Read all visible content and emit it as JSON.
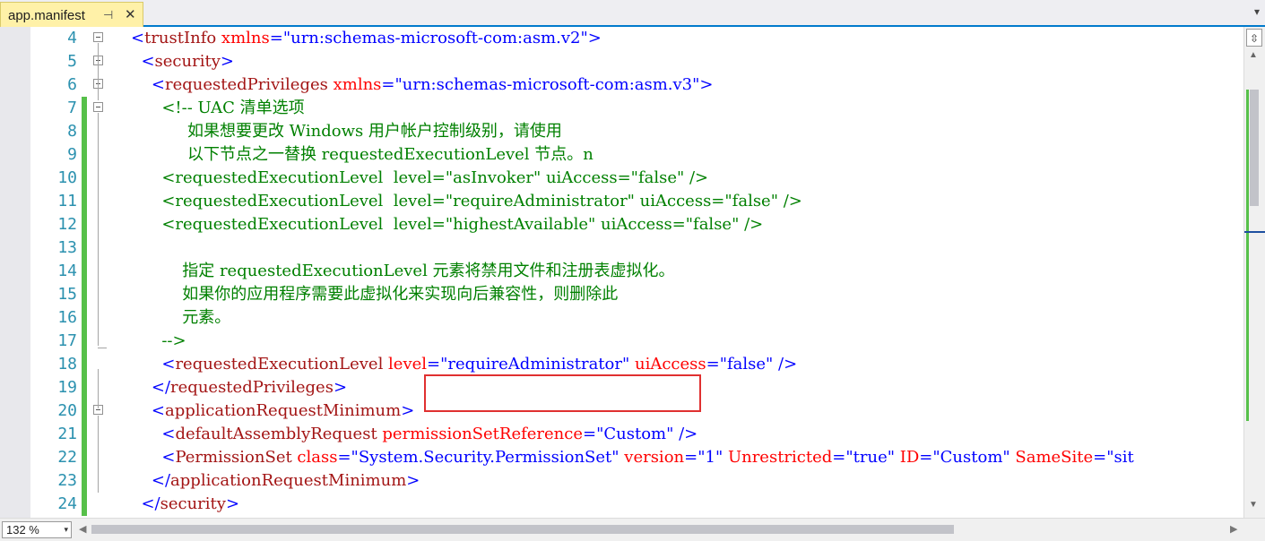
{
  "tab": {
    "title": "app.manifest",
    "pin_glyph": "⊣",
    "close_glyph": "✕",
    "menu_glyph": "▾"
  },
  "scrollbar": {
    "split_glyph": "⇳",
    "up_glyph": "▲",
    "down_glyph": "▼",
    "left_glyph": "◀",
    "right_glyph": "▶"
  },
  "status": {
    "zoom": "132 %",
    "zoom_arrow": "▾"
  },
  "colors": {
    "tag": "#a31515",
    "attribute": "#ff0000",
    "value": "#0000ff",
    "comment": "#008000",
    "changed_marker": "#57c04a",
    "highlight_box": "#e03030"
  },
  "lines": [
    {
      "num": "4",
      "p1": "<",
      "p2": "trustInfo",
      "p3": " xmlns",
      "p4": "=\"urn:schemas-microsoft-com:asm.v2\">",
      "indent": ""
    },
    {
      "num": "5",
      "p1": "<",
      "p2": "security",
      "p3": "",
      "p4": ">",
      "indent": "  "
    },
    {
      "num": "6",
      "p1": "<",
      "p2": "requestedPrivileges",
      "p3": " xmlns",
      "p4": "=\"urn:schemas-microsoft-com:asm.v3\">",
      "indent": "    "
    },
    {
      "num": "7",
      "comment": "<!-- UAC 清单选项",
      "indent": "      "
    },
    {
      "num": "8",
      "comment": "如果想要更改 Windows 用户帐户控制级别，请使用",
      "indent": "           "
    },
    {
      "num": "9",
      "comment": "以下节点之一替换 requestedExecutionLevel 节点。n",
      "indent": "           "
    },
    {
      "num": "10",
      "comment": "<requestedExecutionLevel  level=\"asInvoker\" uiAccess=\"false\" />",
      "indent": "      "
    },
    {
      "num": "11",
      "comment": "<requestedExecutionLevel  level=\"requireAdministrator\" uiAccess=\"false\" />",
      "indent": "      "
    },
    {
      "num": "12",
      "comment": "<requestedExecutionLevel  level=\"highestAvailable\" uiAccess=\"false\" />",
      "indent": "      "
    },
    {
      "num": "13",
      "comment": "",
      "indent": ""
    },
    {
      "num": "14",
      "comment": "指定 requestedExecutionLevel 元素将禁用文件和注册表虚拟化。",
      "indent": "          "
    },
    {
      "num": "15",
      "comment": "如果你的应用程序需要此虚拟化来实现向后兼容性，则删除此",
      "indent": "          "
    },
    {
      "num": "16",
      "comment": "元素。",
      "indent": "          "
    },
    {
      "num": "17",
      "comment": "-->",
      "indent": "      "
    },
    {
      "num": "18",
      "p1": "<",
      "p2": "requestedExecutionLevel",
      "p3": " level",
      "p4": "=\"requireAdministrator\"",
      "p5": " uiAccess",
      "p6": "=\"false\" />",
      "indent": "      "
    },
    {
      "num": "19",
      "p1": "</",
      "p2": "requestedPrivileges",
      "p3": "",
      "p4": ">",
      "indent": "    "
    },
    {
      "num": "20",
      "p1": "<",
      "p2": "applicationRequestMinimum",
      "p3": "",
      "p4": ">",
      "indent": "    "
    },
    {
      "num": "21",
      "p1": "<",
      "p2": "defaultAssemblyRequest",
      "p3": " permissionSetReference",
      "p4": "=\"Custom\" />",
      "indent": "      "
    },
    {
      "num": "22",
      "p1": "<",
      "p2": "PermissionSet",
      "p3": " class",
      "p4": "=\"System.Security.PermissionSet\"",
      "p5": " version",
      "p6": "=\"1\"",
      "p7": " Unrestricted",
      "p8": "=\"true\"",
      "p9": " ID",
      "p10": "=\"Custom\"",
      "p11": " SameSite",
      "p12": "=\"sit",
      "indent": "      "
    },
    {
      "num": "23",
      "p1": "</",
      "p2": "applicationRequestMinimum",
      "p3": "",
      "p4": ">",
      "indent": "    "
    },
    {
      "num": "24",
      "p1": "</",
      "p2": "security",
      "p3": "",
      "p4": ">",
      "indent": "  "
    }
  ]
}
